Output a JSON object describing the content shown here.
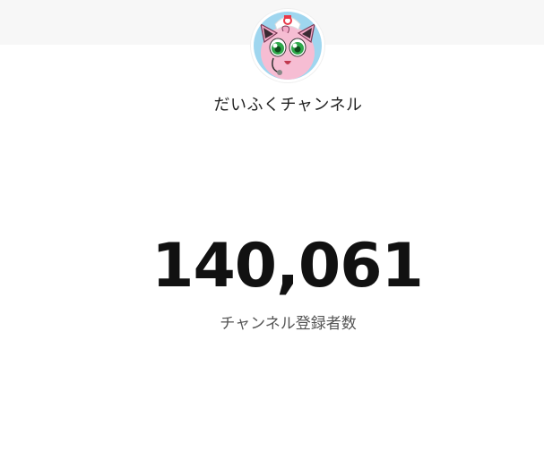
{
  "channel": {
    "name": "だいふくチャンネル",
    "avatar_icon": "jigglypuff-avatar-icon"
  },
  "subscribers": {
    "count": "140,061",
    "label": "チャンネル登録者数"
  },
  "colors": {
    "top_band": "#f7f7f7",
    "background": "#ffffff",
    "count_text": "#111111",
    "label_text": "#555555"
  }
}
